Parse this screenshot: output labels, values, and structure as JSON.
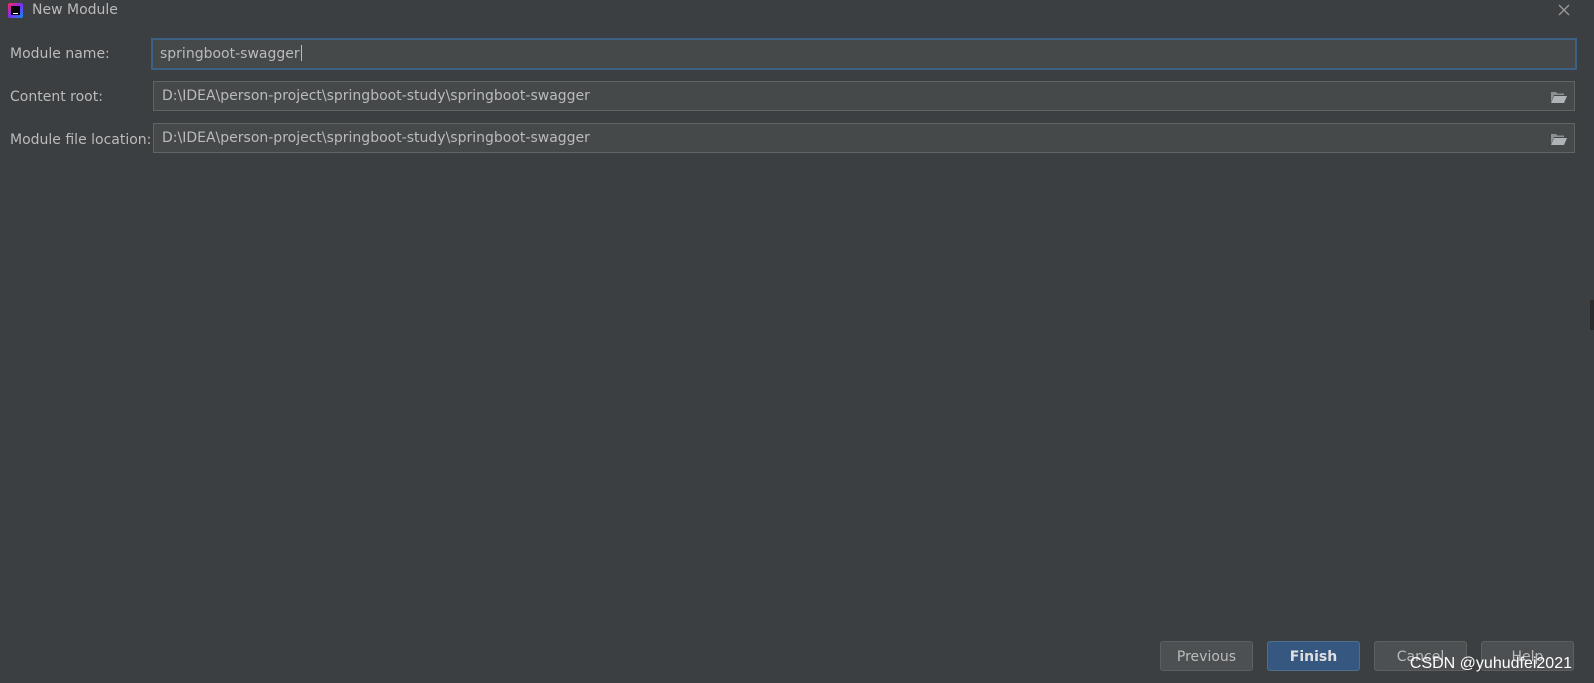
{
  "window": {
    "title": "New Module"
  },
  "form": {
    "module_name": {
      "label": "Module name:",
      "value": "springboot-swagger"
    },
    "content_root": {
      "label": "Content root:",
      "value": "D:\\IDEA\\person-project\\springboot-study\\springboot-swagger"
    },
    "module_file_location": {
      "label": "Module file location:",
      "value": "D:\\IDEA\\person-project\\springboot-study\\springboot-swagger"
    }
  },
  "buttons": {
    "previous": "Previous",
    "finish": "Finish",
    "cancel": "Cancel",
    "help": "Help"
  },
  "watermark": "CSDN @yuhudfei2021",
  "icons": {
    "app": "intellij-idea-icon",
    "close": "close-icon",
    "folder": "folder-open-icon"
  },
  "colors": {
    "background": "#3c3f41",
    "field_background": "#45494a",
    "focus_border": "#3d6185",
    "primary_button": "#365880",
    "text": "#bbbbbb"
  }
}
